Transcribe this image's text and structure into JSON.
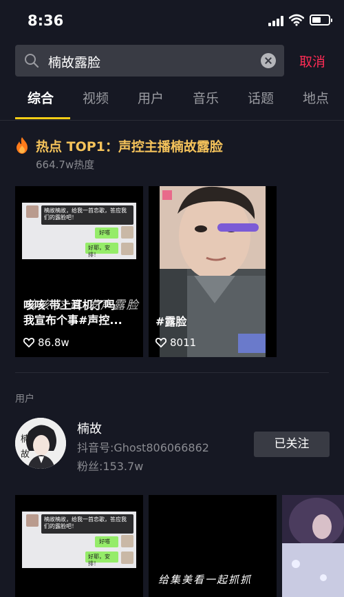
{
  "status_bar": {
    "time": "8:36",
    "icons": [
      "signal-icon",
      "wifi-icon",
      "battery-icon"
    ]
  },
  "search": {
    "query": "楠故露脸",
    "cancel_label": "取消"
  },
  "tabs": [
    {
      "label": "综合",
      "active": true
    },
    {
      "label": "视频",
      "active": false
    },
    {
      "label": "用户",
      "active": false
    },
    {
      "label": "音乐",
      "active": false
    },
    {
      "label": "话题",
      "active": false
    },
    {
      "label": "地点",
      "active": false
    }
  ],
  "hot_topic": {
    "title": "热点 TOP1：声控主播楠故露脸",
    "heat": "664.7w热度"
  },
  "videos": [
    {
      "caption_line1": "咳咳 带上耳机了吗",
      "caption_line2": "我宣布个事#声控...",
      "likes": "86.8w",
      "bubble1": "楠故楠故，给我一首恋歌，答应我们的露脸吧！",
      "bubble2": "好嗒",
      "bubble3": "好耶，安排！",
      "overlay": "咳咳 这谁 发声露脸"
    },
    {
      "caption": "#露脸",
      "likes": "8011"
    }
  ],
  "users_section": {
    "label": "用户",
    "user": {
      "name": "楠故",
      "avatar_text1": "楠",
      "avatar_text2": "故",
      "douyin_id": "抖音号:Ghost806066862",
      "fans": "粉丝:153.7w",
      "follow_label": "已关注"
    }
  },
  "more_videos": [
    {
      "bubble1": "楠故楠故，给我一首恋歌，答应我们的露脸吧！",
      "bubble2": "好嗒",
      "bubble3": "好耶，安排！"
    },
    {
      "overlay": "给集美看一起抓抓"
    },
    {}
  ],
  "colors": {
    "background": "#161823",
    "accent": "#fe2c55",
    "hot": "#f5c35b",
    "underline": "#face15"
  }
}
